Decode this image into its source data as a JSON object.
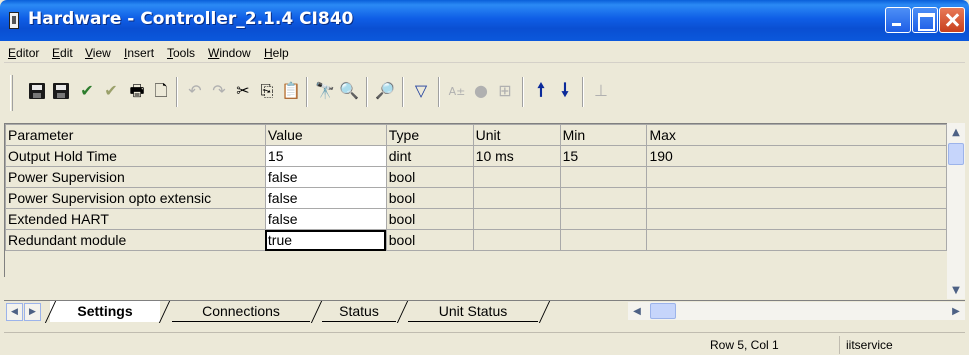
{
  "window": {
    "title": "Hardware - Controller_2.1.4  CI840"
  },
  "menu": [
    "Editor",
    "Edit",
    "View",
    "Insert",
    "Tools",
    "Window",
    "Help"
  ],
  "toolbar": {
    "icons": [
      "save-icon",
      "save-all-icon",
      "check-icon",
      "check-all-icon",
      "print-icon",
      "print-preview-icon",
      "undo-icon",
      "redo-icon",
      "cut-icon",
      "copy-icon",
      "paste-icon",
      "find-icon",
      "find-next-icon",
      "replace-icon",
      "comment-icon",
      "font-icon",
      "breakpoint-icon",
      "tree-icon",
      "up-arrow-icon",
      "down-arrow-icon",
      "anchor-icon"
    ]
  },
  "grid": {
    "columns": [
      "Parameter",
      "Value",
      "Type",
      "Unit",
      "Min",
      "Max"
    ],
    "rows": [
      {
        "parameter": "Output Hold Time",
        "value": "15",
        "type": "dint",
        "unit": "10 ms",
        "min": "15",
        "max": "190"
      },
      {
        "parameter": "Power Supervision",
        "value": "false",
        "type": "bool",
        "unit": "",
        "min": "",
        "max": ""
      },
      {
        "parameter": "Power Supervision opto extensic",
        "value": "false",
        "type": "bool",
        "unit": "",
        "min": "",
        "max": ""
      },
      {
        "parameter": "Extended HART",
        "value": "false",
        "type": "bool",
        "unit": "",
        "min": "",
        "max": ""
      },
      {
        "parameter": "Redundant module",
        "value": "true",
        "type": "bool",
        "unit": "",
        "min": "",
        "max": ""
      }
    ]
  },
  "tabs": [
    "Settings",
    "Connections",
    "Status",
    "Unit Status"
  ],
  "active_tab": "Settings",
  "status": {
    "position": "Row 5, Col 1",
    "user": "iitservice"
  },
  "colors": {
    "titlebar": "#0a50d8",
    "chrome": "#ece9d8",
    "close": "#c8401e"
  }
}
